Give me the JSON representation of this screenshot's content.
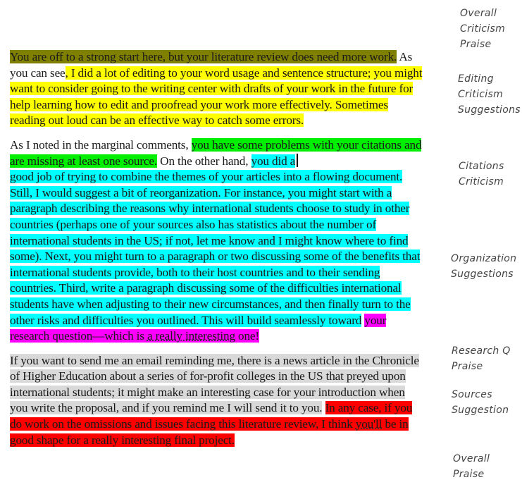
{
  "paragraphs": [
    {
      "segments": [
        {
          "text": "You are off to a strong start here, but your literature review does need more work.",
          "highlight": "olive"
        },
        {
          "text": " As you can see",
          "highlight": "none"
        },
        {
          "text": ", I did a lot of editing to your word usage and sentence structure; you might want to consider going to the writing center with drafts of your work in the future for help learning how to edit and proofread your work more effectively. Sometimes reading out loud can be an effective way to catch some errors.",
          "highlight": "yellow"
        }
      ]
    },
    {
      "segments": [
        {
          "text": "As I noted in the marginal comments, ",
          "highlight": "none"
        },
        {
          "text": "you have some problems with your citations and are missing at least one source.",
          "highlight": "green"
        },
        {
          "text": " On the other hand, ",
          "highlight": "none"
        },
        {
          "text": "you did a",
          "highlight": "cyan"
        },
        {
          "text": "good job of trying to combine the themes of your articles into a flowing document. Still, I would suggest a bit of reorganization. For instance, you might start with a paragraph describing the reasons why international students choose to study in other countries (perhaps one of your sources also has statistics about the number of international students in the US; if not, let me know and I might know where to find some). Next, you might turn to a paragraph or two discussing some of the benefits that international students provide, both to their host countries and to their sending countries. Third, write a paragraph discussing some of the difficulties international students have when adjusting to their new circumstances, and then finally turn to the other risks and difficulties you outlined. This will build seamlessly toward",
          "highlight": "cyan"
        },
        {
          "text": "your research question—which is ",
          "highlight": "magenta"
        },
        {
          "text": "a really interesting",
          "highlight": "magenta"
        },
        {
          "text": " one!",
          "highlight": "magenta"
        }
      ]
    },
    {
      "segments": [
        {
          "text": "If you want to send me an email reminding me, there is a news article in the Chronicle of Higher Education about a series of for-profit colleges in the US that preyed upon international students; it might make an interesting case for your introduction when you write the proposal, and if you remind me I will send it to you.",
          "highlight": "gray"
        },
        {
          "text": " ",
          "highlight": "none"
        },
        {
          "text": "In any case, if you do work on the omissions and issues facing this literature review, I think ",
          "highlight": "red"
        },
        {
          "text": "you'll",
          "highlight": "red"
        },
        {
          "text": " be in good shape for a really interesting final project.",
          "highlight": "red"
        }
      ]
    }
  ],
  "annotations": [
    {
      "lines": [
        "Overall",
        "Criticism",
        "Praise"
      ]
    },
    {
      "lines": [
        "Editing",
        "Criticism",
        "Suggestions"
      ]
    },
    {
      "lines": [
        "Citations",
        "Criticism"
      ]
    },
    {
      "lines": [
        "Organization",
        "Suggestions"
      ]
    },
    {
      "lines": [
        "Research Q",
        "Praise"
      ]
    },
    {
      "lines": [
        "Sources",
        "Suggestion"
      ]
    },
    {
      "lines": [
        "Overall",
        "Praise"
      ]
    }
  ],
  "colors": {
    "olive": "#808000",
    "yellow": "#ffff00",
    "green": "#00ee00",
    "cyan": "#00ffff",
    "magenta": "#ff00ff",
    "gray": "#d9d9d9",
    "red": "#ff0000"
  }
}
